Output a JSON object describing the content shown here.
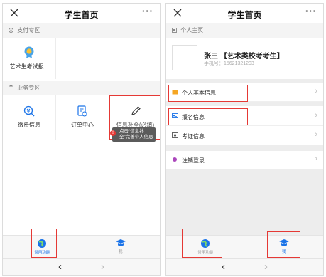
{
  "left": {
    "window_title": "学生首页",
    "more_label": "···",
    "payment_section": {
      "title": "支付专区"
    },
    "payment_tiles": [
      {
        "label": "艺术生考试报..."
      }
    ],
    "business_section": {
      "title": "业务专区"
    },
    "business_tiles": [
      {
        "label": "缴费信息",
        "icon": "money-search-icon"
      },
      {
        "label": "订单中心",
        "icon": "order-icon"
      },
      {
        "label": "信息补全(必填)",
        "icon": "pencil-icon"
      }
    ],
    "tooltip": {
      "badge": "!",
      "line1": "点击“信息补",
      "line2": "全”完善个人信息"
    },
    "tabs": [
      {
        "label": "常用功能",
        "icon": "globe-icon",
        "active": true
      },
      {
        "label": "我",
        "icon": "graduation-cap-icon",
        "active": false
      }
    ],
    "nav": {
      "back": "‹",
      "forward": "›"
    }
  },
  "right": {
    "window_title": "学生首页",
    "more_label": "···",
    "section": {
      "title": "个人主页"
    },
    "profile": {
      "name": "张三 【艺术类校考考生】",
      "phone": "手机号：15621321203"
    },
    "rows": [
      {
        "label": "个人基本信息",
        "icon": "folder-icon"
      },
      {
        "label": "报名信息",
        "icon": "id-card-icon"
      },
      {
        "label": "考证信息",
        "icon": "certificate-icon"
      },
      {
        "label": "注销登录",
        "icon": "logout-icon"
      }
    ],
    "chevron": "›",
    "tabs": [
      {
        "label": "常用功能",
        "icon": "globe-icon",
        "active": false
      },
      {
        "label": "我",
        "icon": "graduation-cap-icon",
        "active": true
      }
    ],
    "nav": {
      "back": "‹",
      "forward": "›"
    }
  },
  "colors": {
    "accent": "#1a73e8",
    "highlight": "#e53935",
    "tooltip": "#5b5b5b"
  }
}
